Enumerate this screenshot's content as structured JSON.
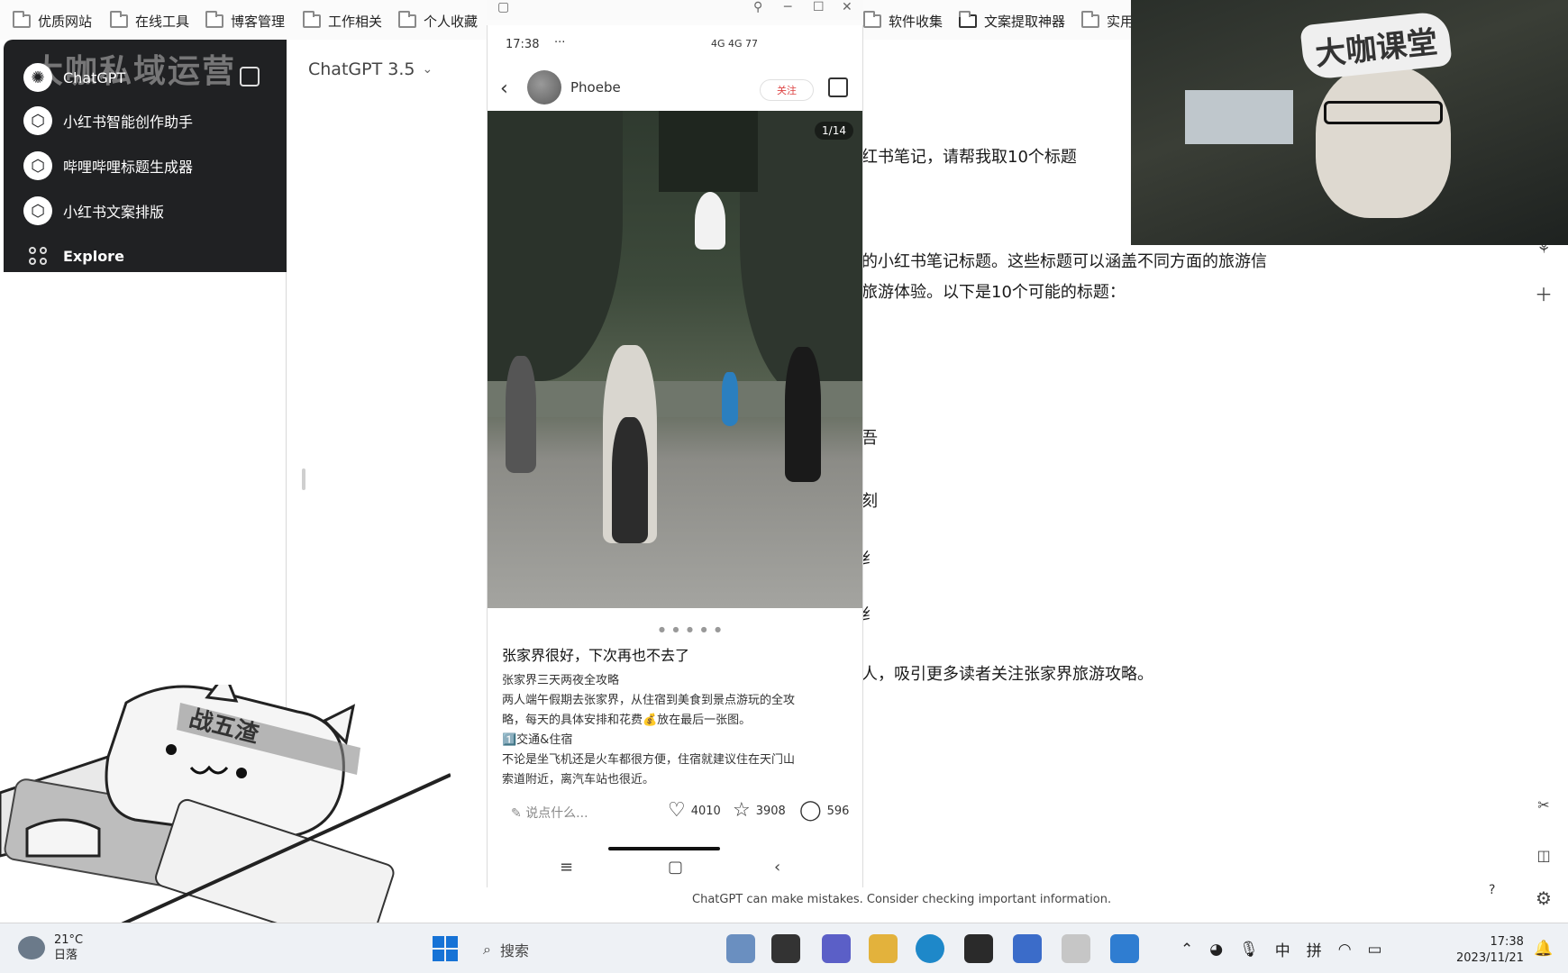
{
  "bookmarks": {
    "left": [
      "优质网站",
      "在线工具",
      "博客管理",
      "工作相关",
      "个人收藏"
    ],
    "right": [
      "软件收集",
      "文案提取神器",
      "实用"
    ]
  },
  "sidebar": {
    "watermark": "大咖私域运营",
    "items": [
      {
        "label": "ChatGPT",
        "icon": "openai-icon"
      },
      {
        "label": "小红书智能创作助手",
        "icon": "gpt-cube-icon"
      },
      {
        "label": "哔哩哔哩标题生成器",
        "icon": "gpt-cube-icon"
      },
      {
        "label": "小红书文案排版",
        "icon": "gpt-cube-icon"
      },
      {
        "label": "Explore",
        "icon": "explore-grid-icon"
      }
    ]
  },
  "chat": {
    "model": "ChatGPT 3.5",
    "lines": [
      "红书笔记，请帮我取10个标题",
      "的小红书笔记标题。这些标题可以涵盖不同方面的旅游信",
      "旅游体验。以下是10个可能的标题：",
      "吾",
      "刻",
      "纟",
      "纟",
      "人，吸引更多读者关注张家界旅游攻略。"
    ],
    "footer": "ChatGPT can make mistakes. Consider checking important information.",
    "help": "?"
  },
  "phone": {
    "status_time": "17:38",
    "status_right": "4G 4G 77",
    "author": "Phoebe",
    "follow": "关注",
    "photo_counter": "1/14",
    "post_title": "张家界很好，下次再也不去了",
    "post_lines": [
      "张家界三天两夜全攻略",
      "两人端午假期去张家界，从住宿到美食到景点游玩的全攻",
      "略，每天的具体安排和花费💰放在最后一张图。",
      "1️⃣交通&住宿",
      "不论是坐飞机还是火车都很方便，住宿就建议住在天门山",
      "索道附近，离汽车站也很近。"
    ],
    "comment_placeholder": "说点什么...",
    "likes": "4010",
    "stars": "3908",
    "comments": "596"
  },
  "webcam": {
    "logo": "大咖课堂"
  },
  "cat": {
    "band": "战五渣"
  },
  "taskbar": {
    "temperature": "21°C",
    "weather": "日落",
    "search": "搜索",
    "ime_lang": "中",
    "ime_mode": "拼",
    "time": "17:38",
    "date": "2023/11/21"
  }
}
